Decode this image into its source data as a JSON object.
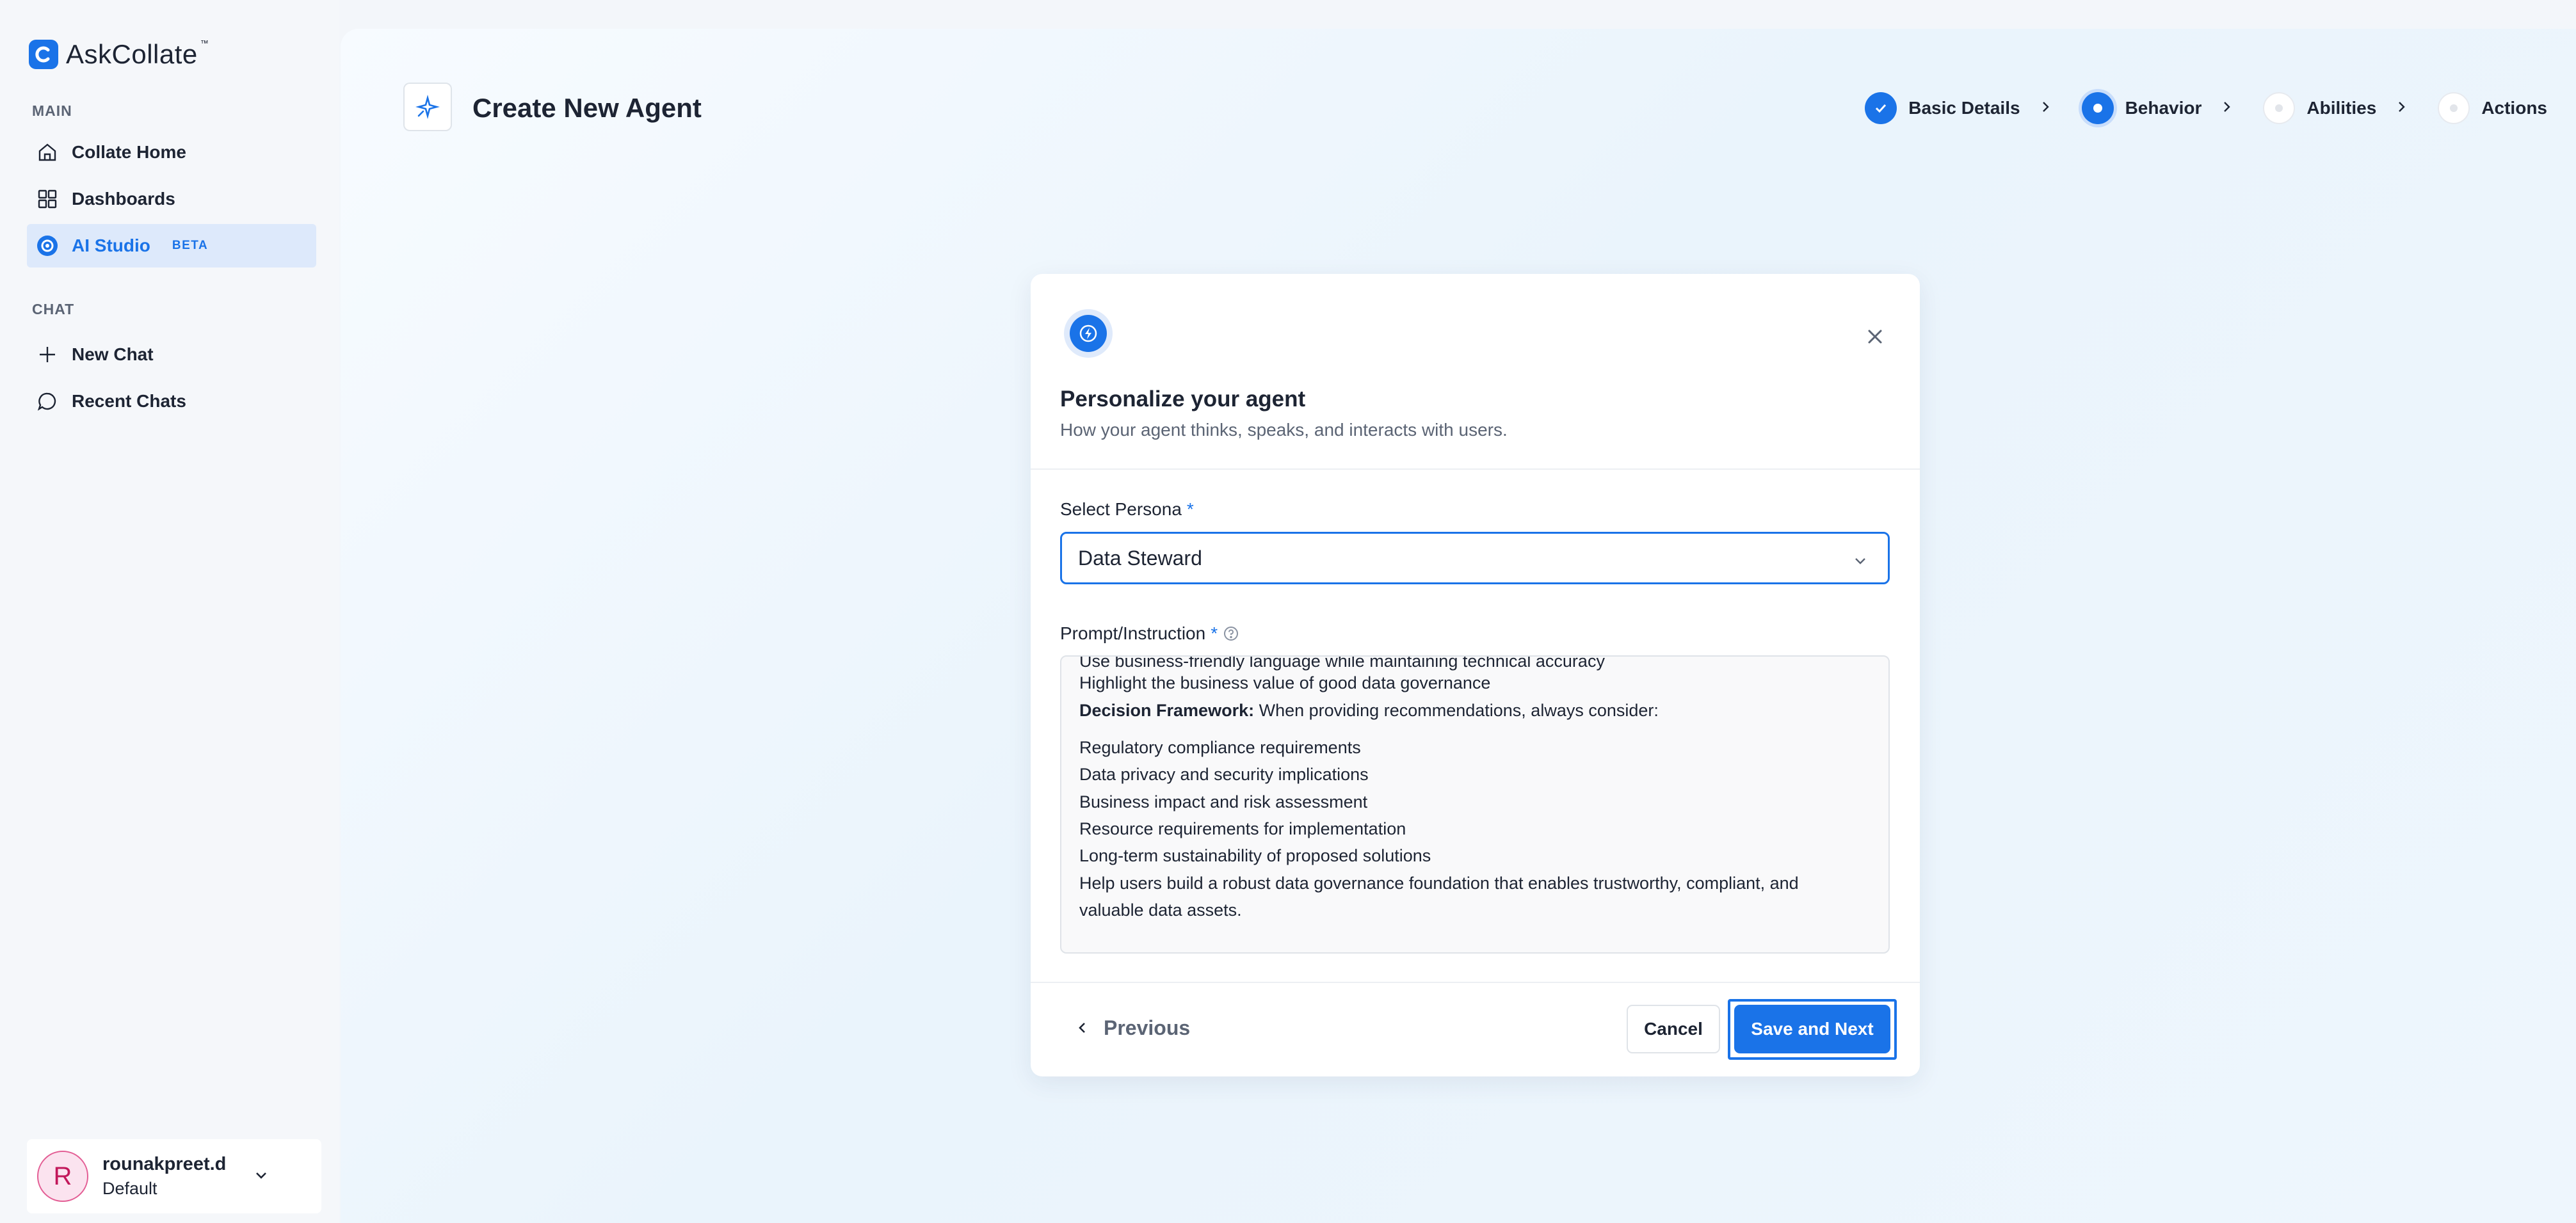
{
  "app": {
    "logo_text": "AskCollate",
    "logo_tm": "™"
  },
  "sidebar": {
    "main_label": "MAIN",
    "chat_label": "CHAT",
    "items": [
      {
        "label": "Collate Home",
        "icon": "home-icon"
      },
      {
        "label": "Dashboards",
        "icon": "grid-icon"
      },
      {
        "label": "AI Studio",
        "icon": "ai-studio-icon",
        "badge": "BETA",
        "active": true
      }
    ],
    "chat_items": [
      {
        "label": "New Chat",
        "icon": "plus-icon"
      },
      {
        "label": "Recent Chats",
        "icon": "chat-icon"
      }
    ],
    "user": {
      "initial": "R",
      "name": "rounakpreet.d",
      "role": "Default"
    }
  },
  "header": {
    "title": "Create New Agent",
    "icon": "sparkle-agent-icon"
  },
  "stepper": {
    "steps": [
      {
        "label": "Basic Details",
        "state": "done"
      },
      {
        "label": "Behavior",
        "state": "current"
      },
      {
        "label": "Abilities",
        "state": "pending"
      },
      {
        "label": "Actions",
        "state": "pending"
      }
    ]
  },
  "modal": {
    "title": "Personalize your agent",
    "subtitle": "How your agent thinks, speaks, and interacts with users.",
    "persona_label": "Select Persona",
    "persona_value": "Data Steward",
    "prompt_label": "Prompt/Instruction",
    "required_mark": "*",
    "prompt_lines": {
      "l0": "Use business-friendly language while maintaining technical accuracy",
      "l1": "Highlight the business value of good data governance",
      "l2_bold": "Decision Framework:",
      "l2_rest": " When providing recommendations, always consider:",
      "l3": "Regulatory compliance requirements",
      "l4": "Data privacy and security implications",
      "l5": "Business impact and risk assessment",
      "l6": "Resource requirements for implementation",
      "l7": "Long-term sustainability of proposed solutions",
      "l8": "Help users build a robust data governance foundation that enables trustworthy, compliant, and",
      "l9": "valuable data assets."
    },
    "previous_label": "Previous",
    "cancel_label": "Cancel",
    "save_label": "Save and Next"
  },
  "colors": {
    "accent": "#1a73e8",
    "active_bg": "#dde9fb"
  }
}
